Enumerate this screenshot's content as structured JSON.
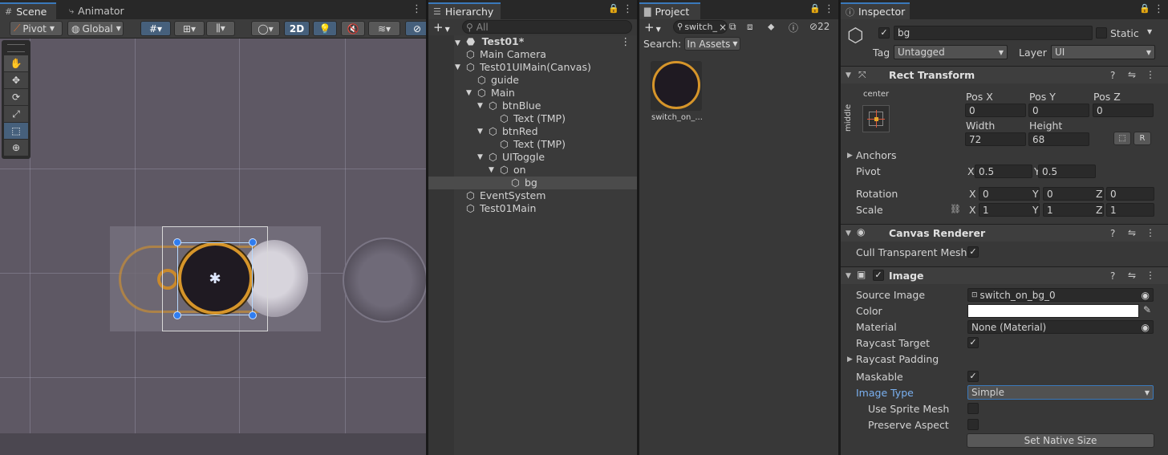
{
  "scene": {
    "tabs": [
      {
        "label": "Scene",
        "icon": "hash-icon"
      },
      {
        "label": "Animator",
        "icon": "animator-icon"
      }
    ],
    "toolbar": {
      "pivot": "Pivot",
      "global": "Global",
      "mode_2d": "2D"
    },
    "tools": [
      "hand-tool-icon",
      "move-tool-icon",
      "rotate-tool-icon",
      "scale-tool-icon",
      "rect-tool-icon",
      "transform-tool-icon"
    ],
    "colors": {
      "bg": "#5e5864",
      "accent": "#e3a32a"
    }
  },
  "hierarchy": {
    "tab": "Hierarchy",
    "search_placeholder": "All",
    "scene_name": "Test01*",
    "items": [
      {
        "label": "Main Camera",
        "depth": 1,
        "expand": ""
      },
      {
        "label": "Test01UIMain(Canvas)",
        "depth": 1,
        "expand": "open"
      },
      {
        "label": "guide",
        "depth": 2,
        "expand": ""
      },
      {
        "label": "Main",
        "depth": 2,
        "expand": "open"
      },
      {
        "label": "btnBlue",
        "depth": 3,
        "expand": "open"
      },
      {
        "label": "Text (TMP)",
        "depth": 4,
        "expand": ""
      },
      {
        "label": "btnRed",
        "depth": 3,
        "expand": "open"
      },
      {
        "label": "Text (TMP)",
        "depth": 4,
        "expand": ""
      },
      {
        "label": "UIToggle",
        "depth": 3,
        "expand": "open"
      },
      {
        "label": "on",
        "depth": 4,
        "expand": "open"
      },
      {
        "label": "bg",
        "depth": 5,
        "expand": "",
        "selected": true
      },
      {
        "label": "EventSystem",
        "depth": 1,
        "expand": ""
      },
      {
        "label": "Test01Main",
        "depth": 1,
        "expand": ""
      }
    ]
  },
  "project": {
    "tab": "Project",
    "search_value": "switch_",
    "hidden_count": "22",
    "search_label": "Search:",
    "search_scope": "In Assets",
    "asset_name": "switch_on_..."
  },
  "inspector": {
    "tab": "Inspector",
    "object_name": "bg",
    "static_label": "Static",
    "tag_label": "Tag",
    "tag_value": "Untagged",
    "layer_label": "Layer",
    "layer_value": "UI",
    "rect_transform": {
      "title": "Rect Transform",
      "anchor_h": "center",
      "anchor_v": "middle",
      "pos_x_label": "Pos X",
      "pos_y_label": "Pos Y",
      "pos_z_label": "Pos Z",
      "pos_x": "0",
      "pos_y": "0",
      "pos_z": "0",
      "width_label": "Width",
      "height_label": "Height",
      "width": "72",
      "height": "68",
      "raw_btn": "R",
      "anchors_label": "Anchors",
      "pivot_label": "Pivot",
      "pivot_x": "0.5",
      "pivot_y": "0.5",
      "rotation_label": "Rotation",
      "rot_x": "0",
      "rot_y": "0",
      "rot_z": "0",
      "scale_label": "Scale",
      "scale_x": "1",
      "scale_y": "1",
      "scale_z": "1",
      "x": "X",
      "y": "Y",
      "z": "Z"
    },
    "canvas_renderer": {
      "title": "Canvas Renderer",
      "cull_label": "Cull Transparent Mesh"
    },
    "image": {
      "title": "Image",
      "source_label": "Source Image",
      "source_value": "switch_on_bg_0",
      "color_label": "Color",
      "color_value": "#ffffff",
      "material_label": "Material",
      "material_value": "None (Material)",
      "raycast_target_label": "Raycast Target",
      "raycast_padding_label": "Raycast Padding",
      "maskable_label": "Maskable",
      "image_type_label": "Image Type",
      "image_type_value": "Simple",
      "use_sprite_mesh_label": "Use Sprite Mesh",
      "preserve_aspect_label": "Preserve Aspect",
      "native_size_btn": "Set Native Size"
    }
  }
}
